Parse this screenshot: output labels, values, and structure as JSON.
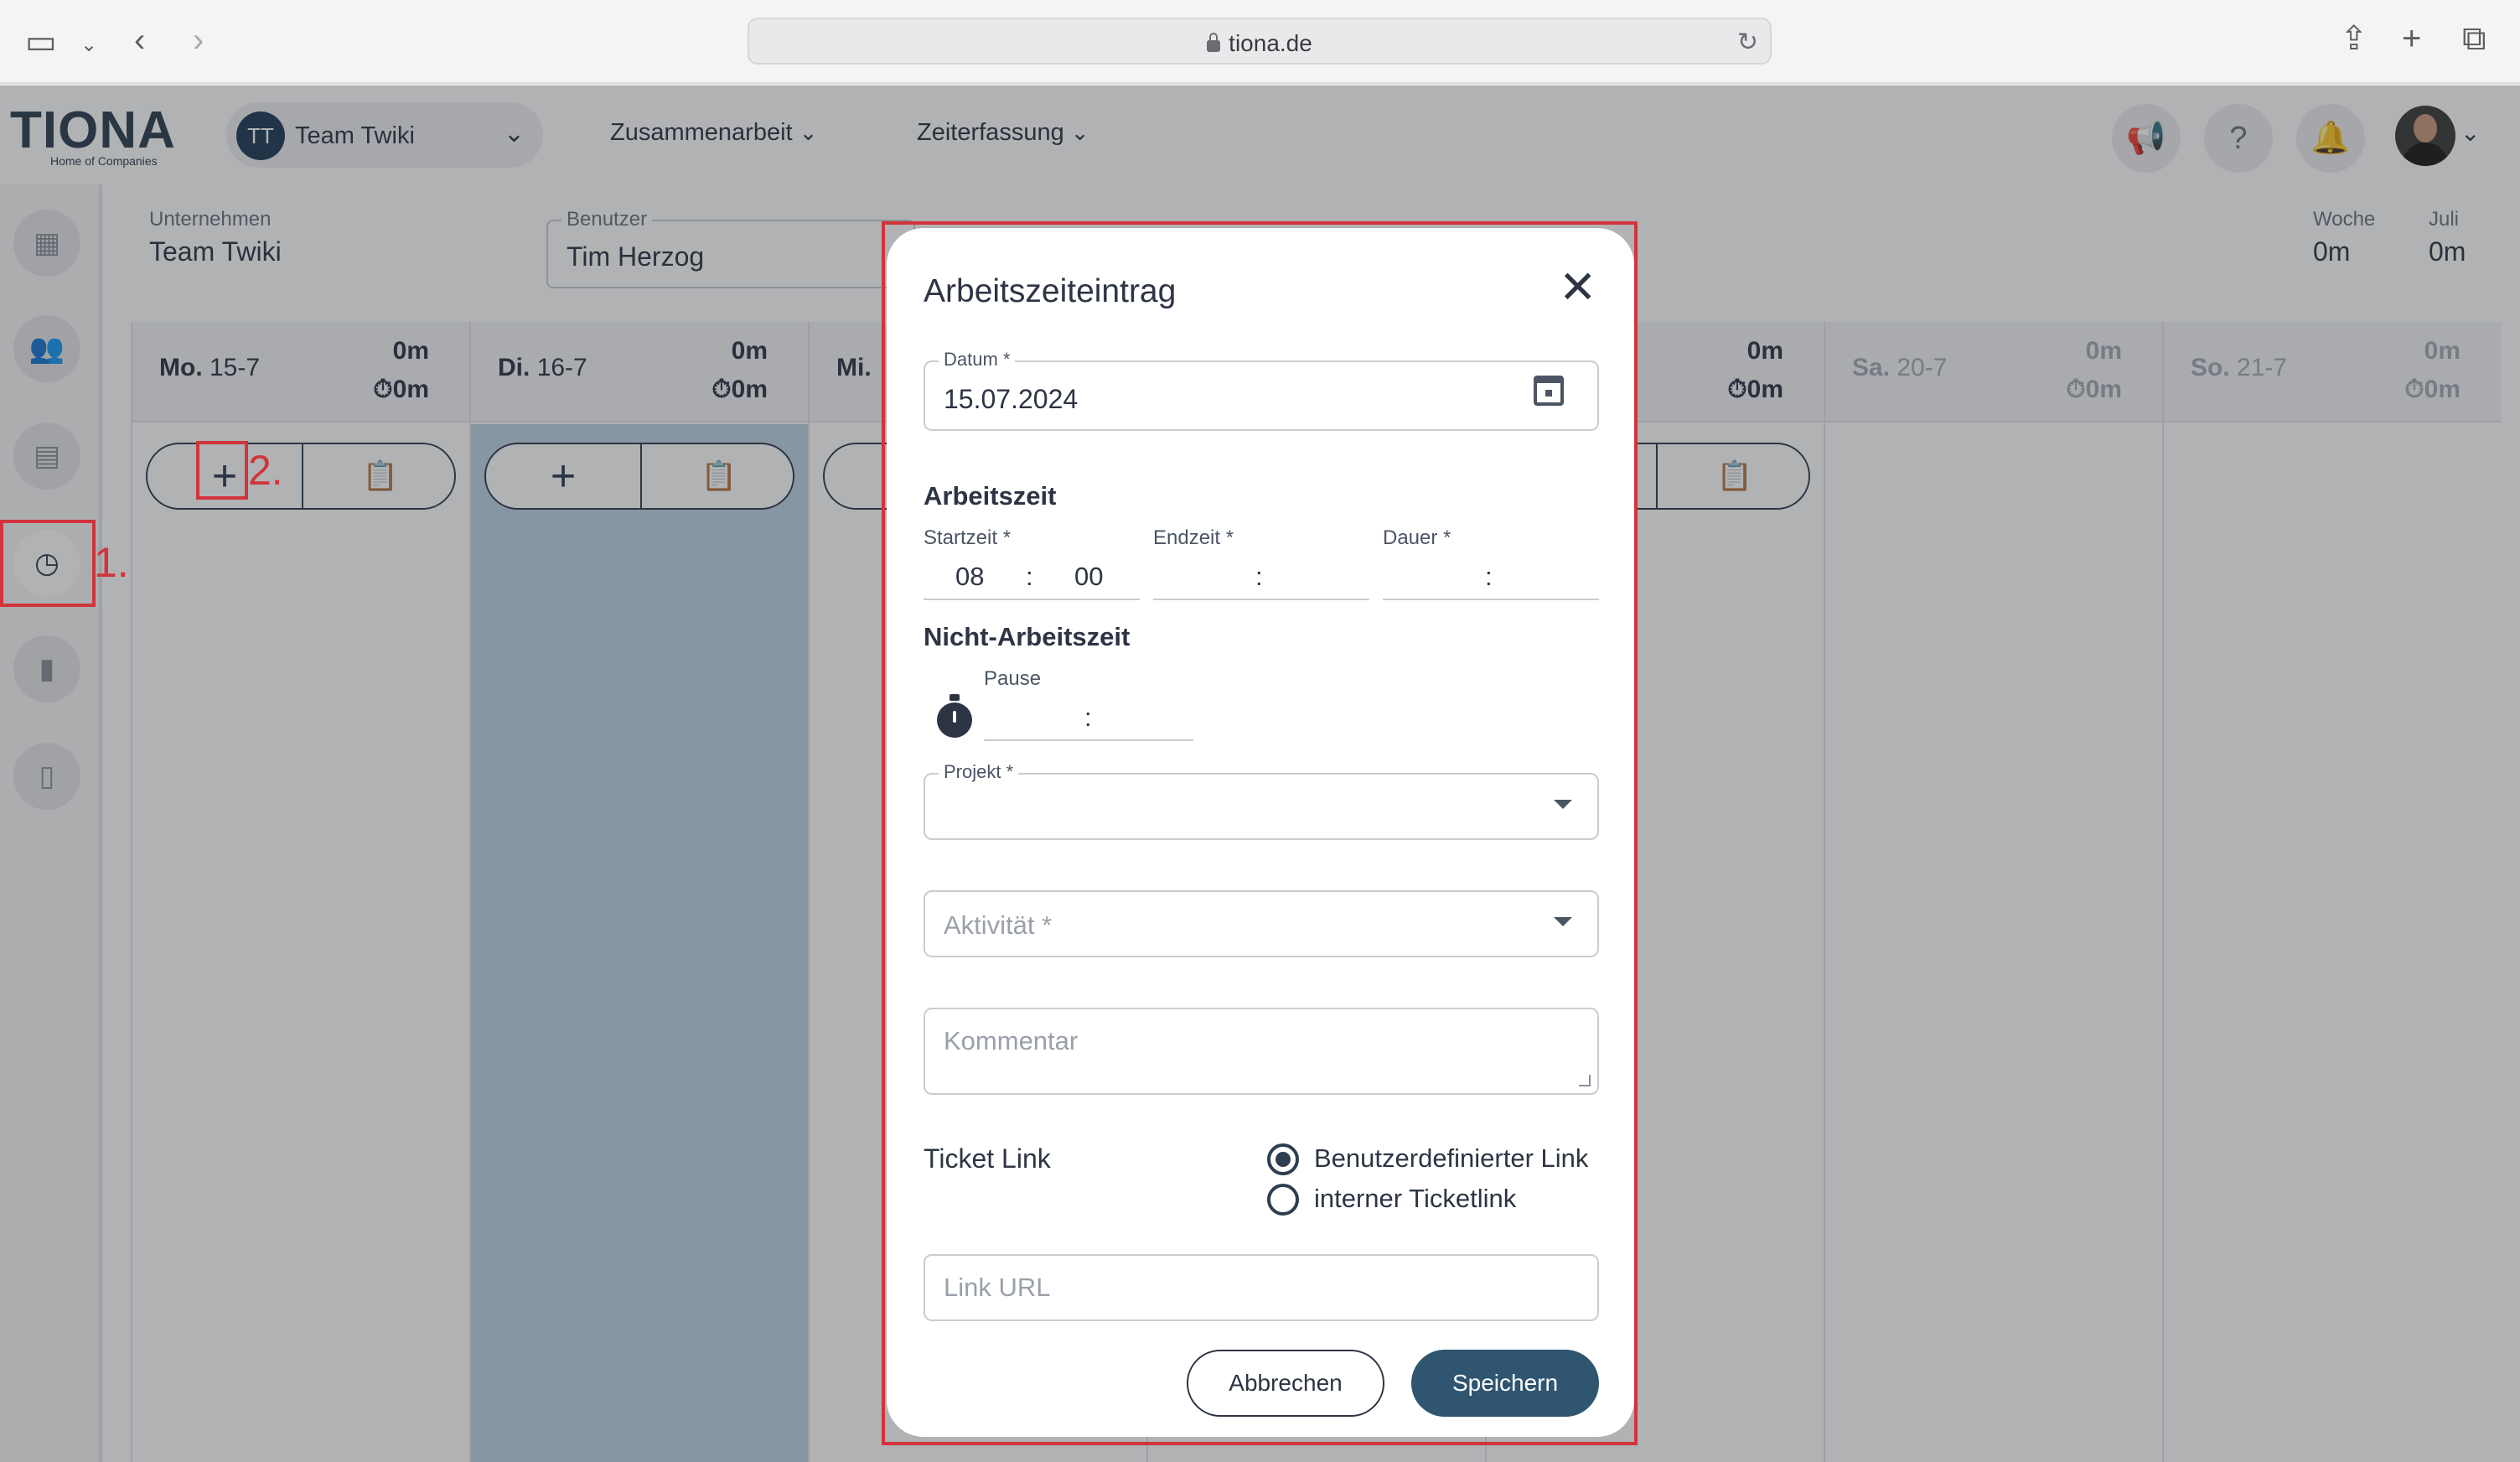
{
  "browser": {
    "url": "tiona.de"
  },
  "header": {
    "logo": "TIONA",
    "logo_tagline": "Home of Companies",
    "team": {
      "initials": "TT",
      "name": "Team Twiki"
    },
    "nav": [
      {
        "label": "Zusammenarbeit"
      },
      {
        "label": "Zeiterfassung"
      }
    ]
  },
  "sidebar": {
    "items": [
      {
        "icon": "dashboard-icon"
      },
      {
        "icon": "people-icon"
      },
      {
        "icon": "calendar-icon"
      },
      {
        "icon": "time-add-icon",
        "active": true
      },
      {
        "icon": "card-icon"
      },
      {
        "icon": "document-check-icon"
      }
    ]
  },
  "filters": {
    "company_label": "Unternehmen",
    "company_value": "Team Twiki",
    "user_label": "Benutzer",
    "user_value": "Tim Herzog"
  },
  "summary": {
    "week_label": "Woche",
    "week_value": "0m",
    "month_label": "Juli",
    "month_value": "0m"
  },
  "days": [
    {
      "abbr": "Mo.",
      "date": "15-7",
      "total": "0m",
      "pause": "0m",
      "weekend": false
    },
    {
      "abbr": "Di.",
      "date": "16-7",
      "total": "0m",
      "pause": "0m",
      "weekend": false
    },
    {
      "abbr": "Mi.",
      "date": "",
      "total": "",
      "pause": "",
      "weekend": false
    },
    {
      "abbr": "",
      "date": "",
      "total": "",
      "pause": "",
      "weekend": false
    },
    {
      "abbr": "",
      "date": "",
      "total": "0m",
      "pause": "0m",
      "weekend": false
    },
    {
      "abbr": "Sa.",
      "date": "20-7",
      "total": "0m",
      "pause": "0m",
      "weekend": true
    },
    {
      "abbr": "So.",
      "date": "21-7",
      "total": "0m",
      "pause": "0m",
      "weekend": true
    }
  ],
  "day_actions": {
    "add": "+",
    "paste": "📋"
  },
  "annotations": {
    "step1": "1.",
    "step2": "2."
  },
  "modal": {
    "title": "Arbeitszeiteintrag",
    "date_label": "Datum *",
    "date_value": "15.07.2024",
    "work_section": "Arbeitszeit",
    "start_label": "Startzeit *",
    "start_hour": "08",
    "start_min": "00",
    "end_label": "Endzeit *",
    "duration_label": "Dauer *",
    "time_sep": ":",
    "nonwork_section": "Nicht-Arbeitszeit",
    "pause_label": "Pause",
    "project_label": "Projekt *",
    "activity_placeholder": "Aktivität *",
    "comment_placeholder": "Kommentar",
    "ticket_label": "Ticket Link",
    "ticket_options": [
      {
        "label": "Benutzerdefinierter Link",
        "selected": true
      },
      {
        "label": "interner Ticketlink",
        "selected": false
      }
    ],
    "link_placeholder": "Link URL",
    "cancel_label": "Abbrechen",
    "save_label": "Speichern"
  }
}
